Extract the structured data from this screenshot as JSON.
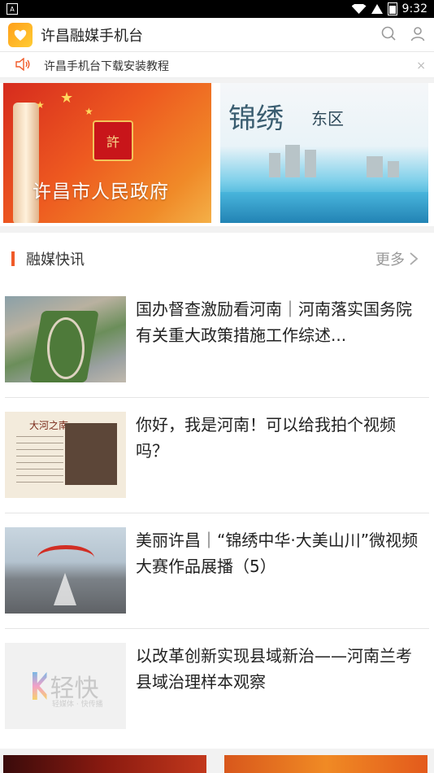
{
  "status_bar": {
    "time": "9:32"
  },
  "app": {
    "title": "许昌融媒手机台"
  },
  "notice": {
    "text": "许昌手机台下载安装教程",
    "close": "×"
  },
  "banners": [
    {
      "text": "许昌市人民政府",
      "seal": "許"
    },
    {
      "calligraphy": "锦绣",
      "calligraphy2": "东区"
    }
  ],
  "section": {
    "title": "融媒快讯",
    "more": "更多"
  },
  "news": [
    {
      "title": "国办督查激励看河南｜河南落实国务院有关重大政策措施工作综述..."
    },
    {
      "title": "你好，我是河南！可以给我拍个视频吗？",
      "thumb_caption": "大河之南"
    },
    {
      "title": "美丽许昌｜“锦绣中华·大美山川”微视频大赛作品展播（5）"
    },
    {
      "title": "以改革创新实现县域新治——河南兰考县域治理样本观察",
      "thumb_brand": "轻快",
      "thumb_slogan": "轻媒体 · 快传播"
    }
  ],
  "colors": {
    "accent": "#f05a28",
    "logo": "#ffb020"
  },
  "icons": [
    "search-icon",
    "user-icon",
    "speaker-icon",
    "chevron-right-icon"
  ]
}
